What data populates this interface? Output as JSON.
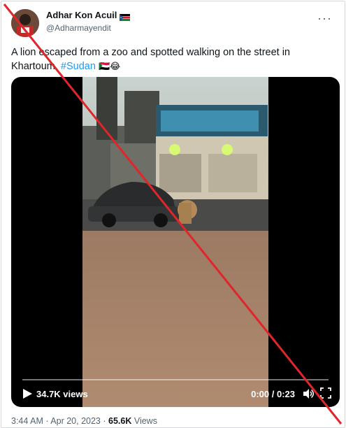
{
  "author": {
    "name": "Adhar Kon Acuil",
    "handle": "@Adharmayendit",
    "avatar_icon": "avatar-photo",
    "flag_icon": "south-sudan-flag-icon"
  },
  "more_icon": "more-options-icon",
  "tweet": {
    "text_part1": "A lion escaped from a zoo and spotted walking on the street in Khartoum. ",
    "hashtag": "#Sudan",
    "emoji_flag": "🇸🇩",
    "emoji_laugh": "😂"
  },
  "video": {
    "views": "34.7K views",
    "time": "0:00 / 0:23",
    "progress": 0,
    "play_icon": "play-icon",
    "volume_icon": "volume-icon",
    "fullscreen_icon": "fullscreen-icon"
  },
  "meta": {
    "time": "3:44 AM",
    "sep1": " · ",
    "date": "Apr 20, 2023",
    "sep2": " · ",
    "views_count": "65.6K",
    "views_label": " Views"
  },
  "overlay": {
    "color": "#e0252b"
  }
}
